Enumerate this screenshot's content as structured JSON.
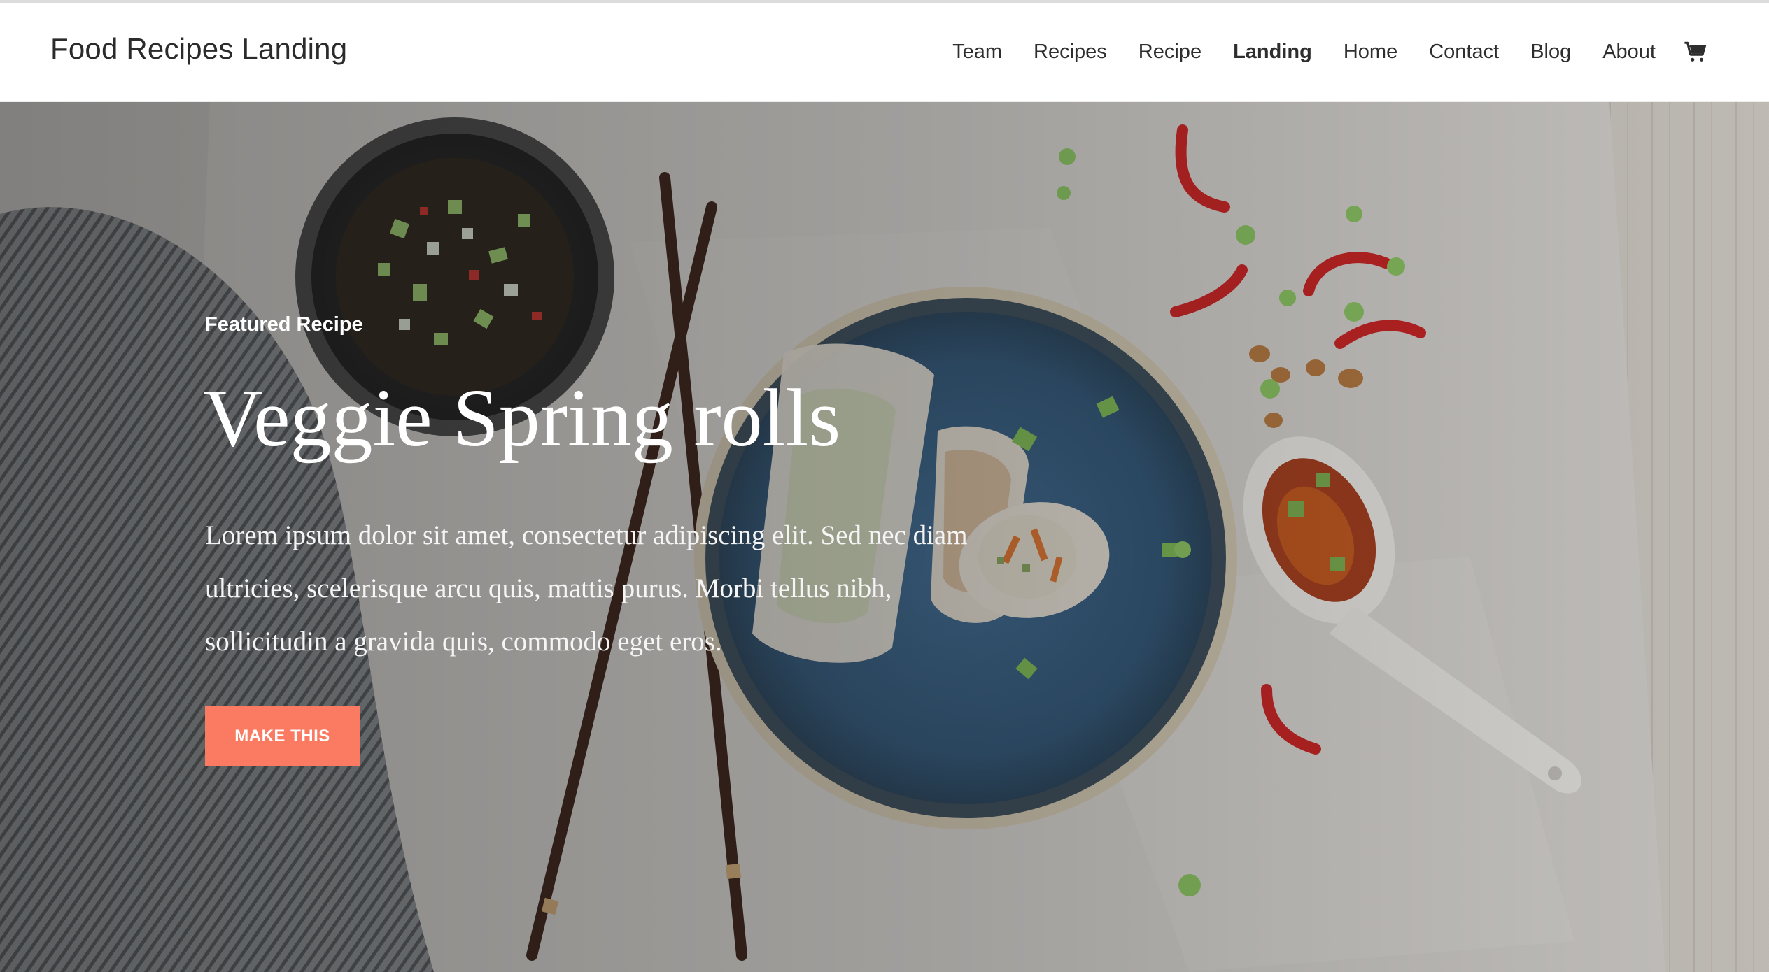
{
  "header": {
    "site_title": "Food Recipes Landing",
    "nav": [
      {
        "label": "Team"
      },
      {
        "label": "Recipes"
      },
      {
        "label": "Recipe"
      },
      {
        "label": "Landing",
        "active": true
      },
      {
        "label": "Home"
      },
      {
        "label": "Contact"
      },
      {
        "label": "Blog"
      },
      {
        "label": "About"
      }
    ],
    "cart_icon": "cart-icon"
  },
  "hero": {
    "eyebrow": "Featured Recipe",
    "title": "Veggie Spring rolls",
    "description": "Lorem ipsum dolor sit amet, consectetur adipiscing elit. Sed nec diam ultricies, scelerisque arcu quis, mattis purus. Morbi tellus nibh, sollicitudin a gravida quis, commodo eget eros.",
    "cta_label": "MAKE THIS",
    "cta_color": "#fa7a62"
  }
}
